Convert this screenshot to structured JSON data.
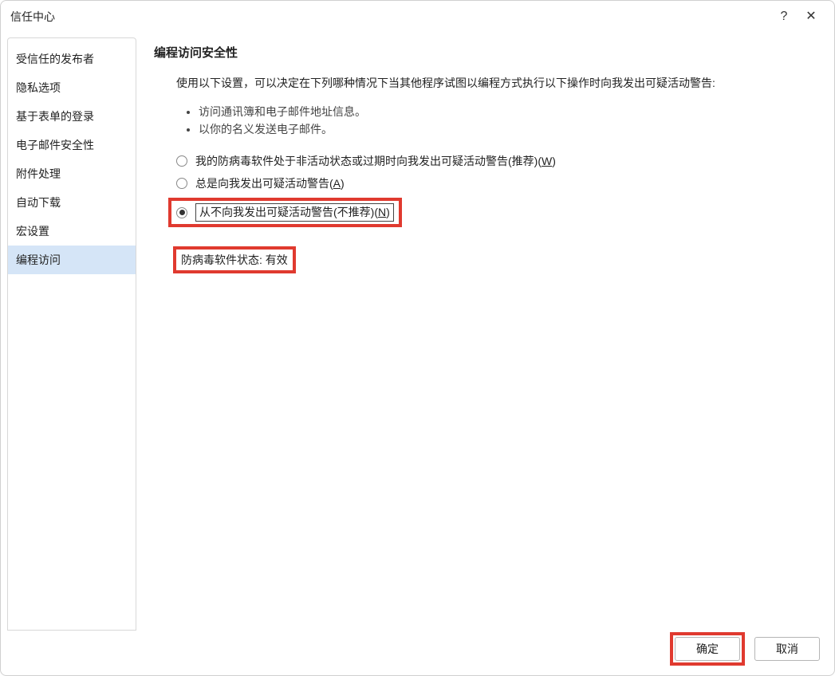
{
  "dialog": {
    "title": "信任中心"
  },
  "sidebar": {
    "items": [
      {
        "label": "受信任的发布者",
        "selected": false
      },
      {
        "label": "隐私选项",
        "selected": false
      },
      {
        "label": "基于表单的登录",
        "selected": false
      },
      {
        "label": "电子邮件安全性",
        "selected": false
      },
      {
        "label": "附件处理",
        "selected": false
      },
      {
        "label": "自动下载",
        "selected": false
      },
      {
        "label": "宏设置",
        "selected": false
      },
      {
        "label": "编程访问",
        "selected": true
      }
    ]
  },
  "main": {
    "section_title": "编程访问安全性",
    "intro": "使用以下设置，可以决定在下列哪种情况下当其他程序试图以编程方式执行以下操作时向我发出可疑活动警告:",
    "bullets": [
      "访问通讯簿和电子邮件地址信息。",
      "以你的名义发送电子邮件。"
    ],
    "radios": [
      {
        "label_pre": "我的防病毒软件处于非活动状态或过期时向我发出可疑活动警告(推荐)(",
        "hotkey": "W",
        "label_post": ")",
        "checked": false,
        "highlighted": false
      },
      {
        "label_pre": "总是向我发出可疑活动警告(",
        "hotkey": "A",
        "label_post": ")",
        "checked": false,
        "highlighted": false
      },
      {
        "label_pre": "从不向我发出可疑活动警告(不推荐)(",
        "hotkey": "N",
        "label_post": ")",
        "checked": true,
        "highlighted": true
      }
    ],
    "status": "防病毒软件状态: 有效"
  },
  "footer": {
    "ok": "确定",
    "cancel": "取消"
  },
  "icons": {
    "help": "?",
    "close": "✕"
  }
}
